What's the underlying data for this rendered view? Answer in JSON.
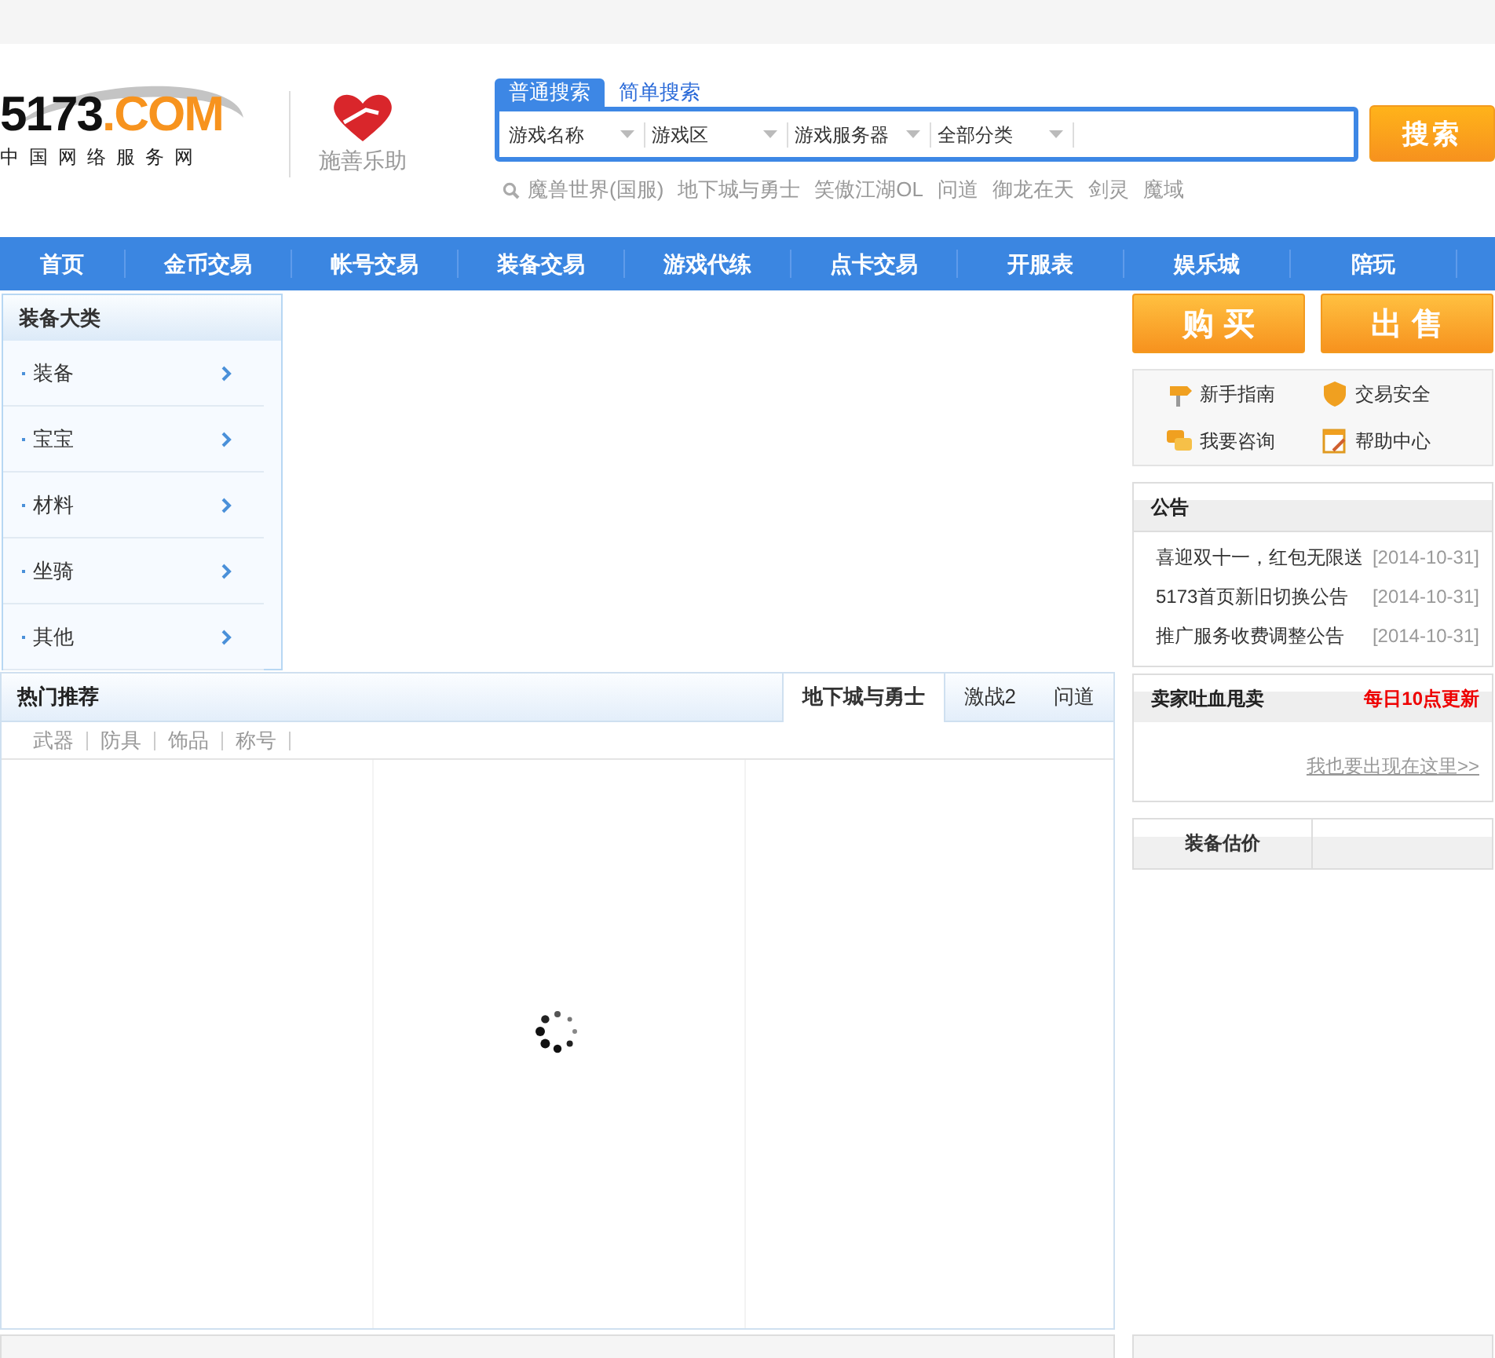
{
  "logo": {
    "number": "5173",
    "domain": ".COM",
    "tagline": "中国网络服务网"
  },
  "charity": {
    "label": "施善乐助"
  },
  "search": {
    "tabs": [
      {
        "label": "普通搜索",
        "selected": true
      },
      {
        "label": "简单搜索",
        "selected": false
      }
    ],
    "dropdowns": [
      "游戏名称",
      "游戏区",
      "游戏服务器",
      "全部分类"
    ],
    "button": "搜索",
    "hot_words": [
      "魔兽世界(国服)",
      "地下城与勇士",
      "笑傲江湖OL",
      "问道",
      "御龙在天",
      "剑灵",
      "魔域"
    ]
  },
  "nav": [
    "首页",
    "金币交易",
    "帐号交易",
    "装备交易",
    "游戏代练",
    "点卡交易",
    "开服表",
    "娱乐城",
    "陪玩"
  ],
  "categories": {
    "title": "装备大类",
    "items": [
      "装备",
      "宝宝",
      "材料",
      "坐骑",
      "其他"
    ]
  },
  "hot": {
    "title": "热门推荐",
    "tabs": [
      {
        "label": "地下城与勇士",
        "selected": true
      },
      {
        "label": "激战2",
        "selected": false
      },
      {
        "label": "问道",
        "selected": false
      }
    ],
    "filters": [
      "武器",
      "防具",
      "饰品",
      "称号"
    ],
    "loading": true
  },
  "trade_buttons": [
    "购 买",
    "出 售"
  ],
  "help_links": [
    {
      "label": "新手指南",
      "kind": "signpost"
    },
    {
      "label": "交易安全",
      "kind": "shield"
    },
    {
      "label": "我要咨询",
      "kind": "chat"
    },
    {
      "label": "帮助中心",
      "kind": "notepad"
    }
  ],
  "notice": {
    "title": "公告",
    "items": [
      {
        "text": "喜迎双十一，红包无限送",
        "date": "[2014-10-31]"
      },
      {
        "text": "5173首页新旧切换公告",
        "date": "[2014-10-31]"
      },
      {
        "text": "推广服务收费调整公告",
        "date": "[2014-10-31]"
      }
    ]
  },
  "seller": {
    "title": "卖家吐血甩卖",
    "badge": "每日10点更新",
    "link": "我也要出现在这里>>"
  },
  "estimate": {
    "tabs": [
      "装备估价"
    ]
  }
}
